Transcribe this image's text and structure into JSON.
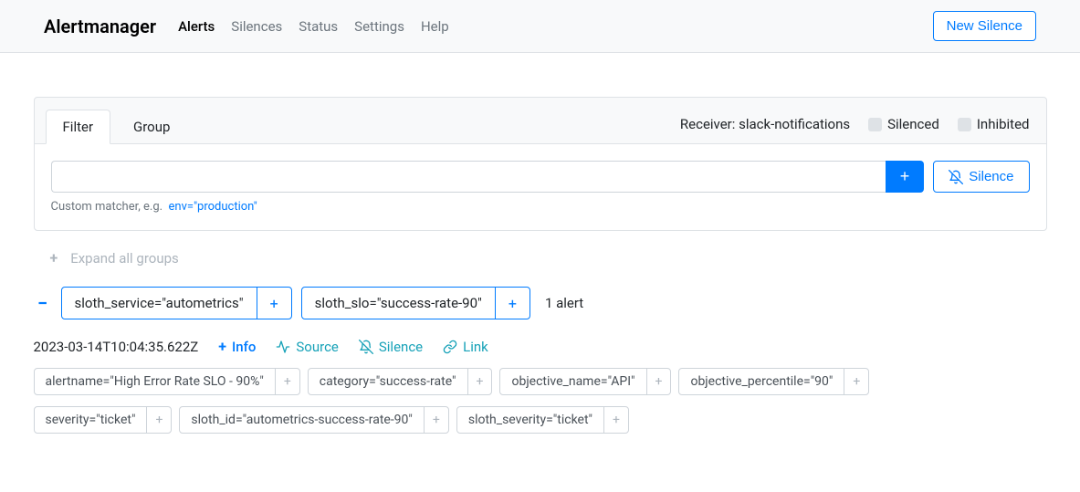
{
  "nav": {
    "brand": "Alertmanager",
    "links": {
      "alerts": "Alerts",
      "silences": "Silences",
      "status": "Status",
      "settings": "Settings",
      "help": "Help"
    },
    "new_silence": "New Silence"
  },
  "filter": {
    "tab_filter": "Filter",
    "tab_group": "Group",
    "receiver_prefix": "Receiver: ",
    "receiver": "slack-notifications",
    "silenced": "Silenced",
    "inhibited": "Inhibited",
    "add": "+",
    "silence": "Silence",
    "hint_prefix": "Custom matcher, e.g.",
    "hint_example": "env=\"production\""
  },
  "expand_all": "Expand all groups",
  "group": {
    "labels": [
      "sloth_service=\"autometrics\"",
      "sloth_slo=\"success-rate-90\""
    ],
    "count": "1 alert"
  },
  "alert": {
    "timestamp": "2023-03-14T10:04:35.622Z",
    "actions": {
      "info": "Info",
      "source": "Source",
      "silence": "Silence",
      "link": "Link"
    },
    "labels": [
      "alertname=\"High Error Rate SLO - 90%\"",
      "category=\"success-rate\"",
      "objective_name=\"API\"",
      "objective_percentile=\"90\"",
      "severity=\"ticket\"",
      "sloth_id=\"autometrics-success-rate-90\"",
      "sloth_severity=\"ticket\""
    ]
  }
}
